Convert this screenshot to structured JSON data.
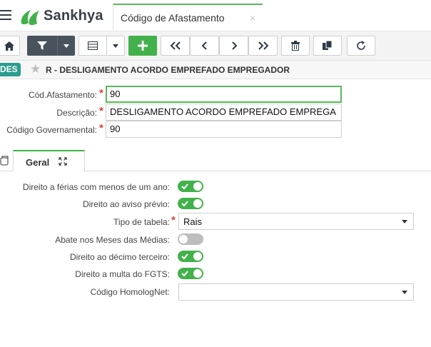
{
  "header": {
    "brand": "Sankhya",
    "tab_title": "Código de Afastamento",
    "tab_close": "×",
    "accent": "#5cb85c"
  },
  "toolbar": {
    "buttons": [
      "home-icon",
      "filter-icon",
      "dropdown-icon",
      "grid-icon",
      "dropdown-icon",
      "add-icon",
      "first-icon",
      "previous-icon",
      "next-icon",
      "last-icon",
      "delete-icon",
      "copy-icon",
      "refresh-icon"
    ],
    "add_color": "#43b14b"
  },
  "breadcrumb": {
    "badge": "DES",
    "title": "R - DESLIGAMENTO ACORDO EMPREFADO EMPREGADOR"
  },
  "form": {
    "cod_label": "Cód.Afastamento:",
    "cod_value": "90",
    "desc_label": "Descrição:",
    "desc_value": "DESLIGAMENTO ACORDO EMPREFADO EMPREGA",
    "gov_label": "Código Governamental:",
    "gov_value": "90",
    "required_mark": "*"
  },
  "tabs": {
    "geral": "Geral"
  },
  "geral": {
    "ferias_label": "Direito a férias com menos de um ano:",
    "ferias_on": true,
    "aviso_label": "Direito ao aviso prévio:",
    "aviso_on": true,
    "tipo_label": "Tipo de tabela:",
    "tipo_value": "Rais",
    "abate_label": "Abate nos Meses das Médias:",
    "abate_on": false,
    "decimo_label": "Direito ao décimo terceiro:",
    "decimo_on": true,
    "fgts_label": "Direito a multa do FGTS:",
    "fgts_on": true,
    "homolog_label": "Código HomologNet:",
    "homolog_value": ""
  }
}
